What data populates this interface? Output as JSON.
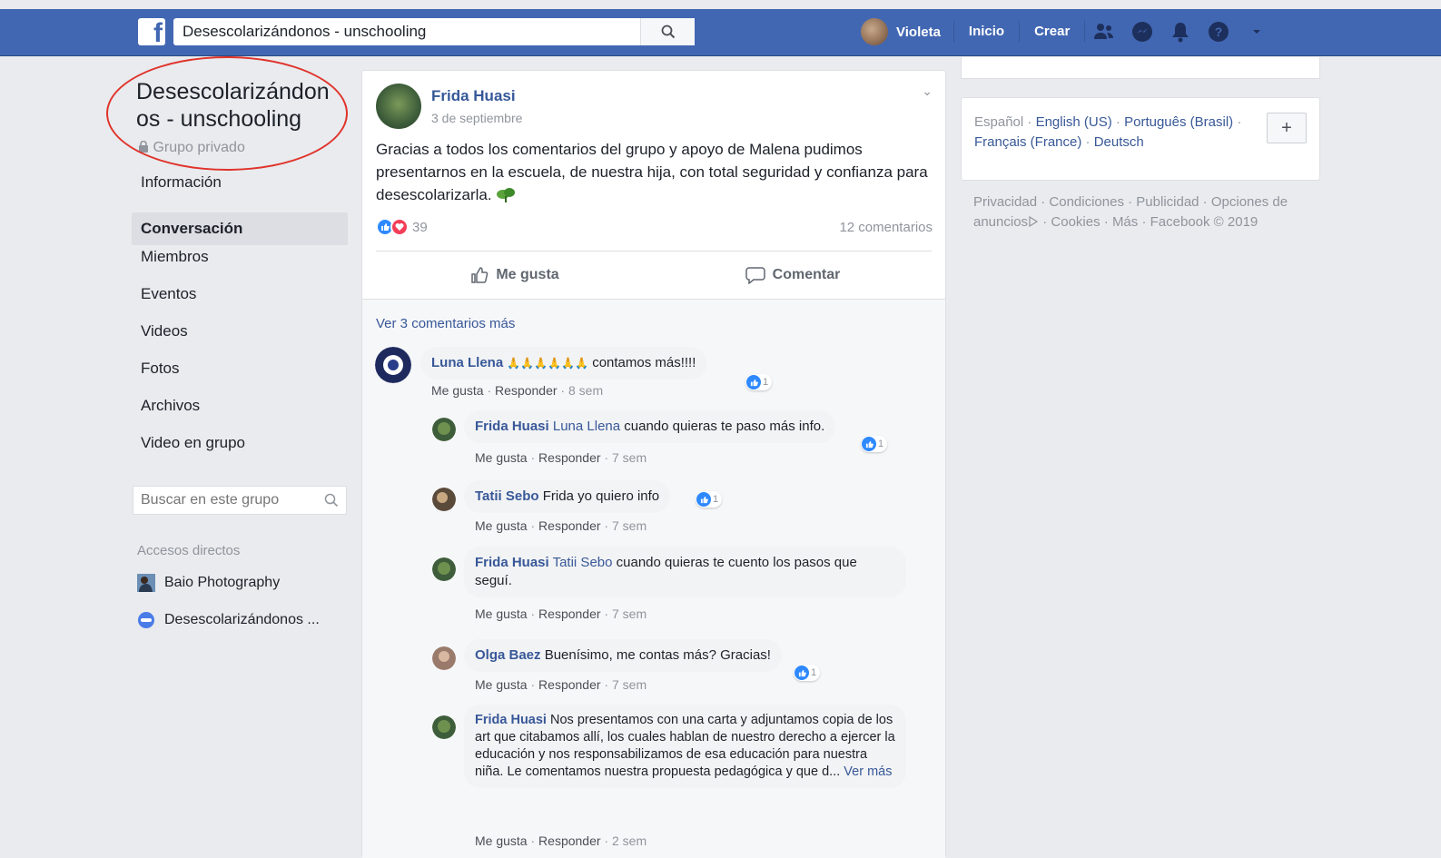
{
  "header": {
    "search_value": "Desescolarizándonos - unschooling",
    "user_name": "Violeta",
    "nav_home": "Inicio",
    "nav_create": "Crear",
    "logo_letter": "f"
  },
  "colors": {
    "brand": "#4267b2",
    "link": "#385898",
    "highlight": "#e0332b"
  },
  "group": {
    "title": "Desescolarizándonos - unschooling",
    "title_line1": "Desescolarizándon",
    "title_line2": "os - unschooling",
    "type": "Grupo privado"
  },
  "left_nav": {
    "items": [
      "Información",
      "Conversación",
      "Miembros",
      "Eventos",
      "Videos",
      "Fotos",
      "Archivos",
      "Video en grupo"
    ],
    "active": "Conversación",
    "search_placeholder": "Buscar en este grupo",
    "shortcuts_heading": "Accesos directos",
    "shortcuts": [
      "Baio Photography",
      "Desescolarizándonos ..."
    ]
  },
  "post": {
    "author": "Frida Huasi",
    "date": "3 de septiembre",
    "text": "Gracias a todos los comentarios del grupo y apoyo de Malena pudimos presentarnos en la escuela, de nuestra hija, con total seguridad y confianza para desescolarizarla.",
    "reaction_count": "39",
    "comment_count": "12 comentarios",
    "like_label": "Me gusta",
    "comment_label": "Comentar",
    "more_comments": "Ver 3 comentarios más"
  },
  "comments": [
    {
      "author": "Luna Llena",
      "tag": "",
      "text": "contamos más!!!!",
      "emoji": "🙏🙏🙏🙏🙏🙏",
      "like": "Me gusta",
      "reply": "Responder",
      "time": "8 sem",
      "likes": "1"
    },
    {
      "author": "Frida Huasi",
      "tag": "Luna Llena",
      "text": "cuando quieras te paso más info.",
      "like": "Me gusta",
      "reply": "Responder",
      "time": "7 sem",
      "likes": "1"
    },
    {
      "author": "Tatii Sebo",
      "tag": "",
      "text": "Frida yo quiero info",
      "like": "Me gusta",
      "reply": "Responder",
      "time": "7 sem",
      "likes": "1"
    },
    {
      "author": "Frida Huasi",
      "tag": "Tatii Sebo",
      "text": "cuando quieras te cuento los pasos que seguí.",
      "like": "Me gusta",
      "reply": "Responder",
      "time": "7 sem"
    },
    {
      "author": "Olga Baez",
      "tag": "",
      "text": "Buenísimo, me contas más? Gracias!",
      "like": "Me gusta",
      "reply": "Responder",
      "time": "7 sem",
      "likes": "1"
    },
    {
      "author": "Frida Huasi",
      "tag": "",
      "text": "Nos presentamos con una carta y adjuntamos copia de los art que citabamos allí, los cuales hablan de nuestro derecho a ejercer la educación y nos responsabilizamos de esa educación para nuestra niña. Le comentamos nuestra propuesta pedagógica y que d...",
      "see_more": "Ver más",
      "like": "Me gusta",
      "reply": "Responder",
      "time": "2 sem"
    }
  ],
  "right": {
    "lang_current": "Español",
    "lang_options": [
      "English (US)",
      "Português (Brasil)",
      "Français (France)",
      "Deutsch"
    ],
    "plus": "+",
    "footer": [
      "Privacidad",
      "Condiciones",
      "Publicidad",
      "Opciones de anuncios",
      "Cookies",
      "Más"
    ],
    "copyright": "Facebook © 2019"
  }
}
